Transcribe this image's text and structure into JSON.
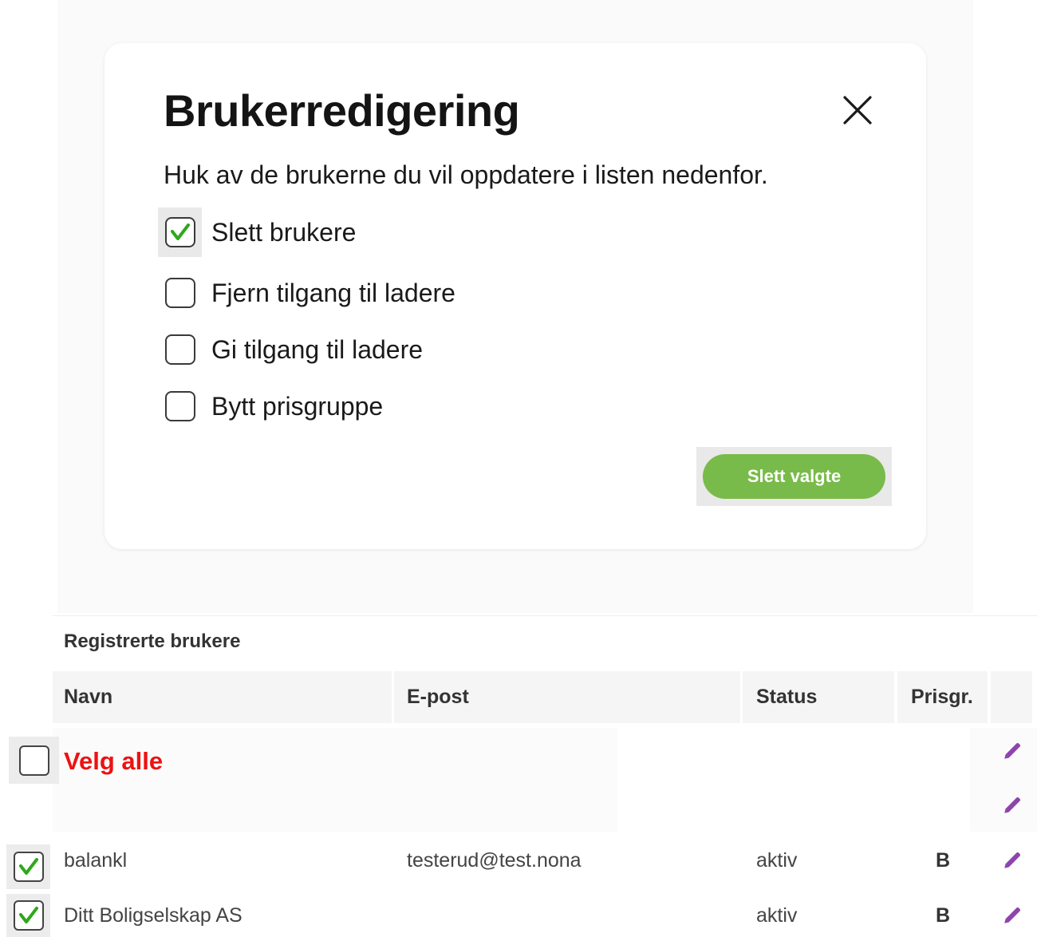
{
  "modal": {
    "title": "Brukerredigering",
    "description": "Huk av de brukerne du vil oppdatere i listen nedenfor.",
    "options": [
      {
        "label": "Slett brukere",
        "checked": true
      },
      {
        "label": "Fjern tilgang til ladere",
        "checked": false
      },
      {
        "label": "Gi tilgang til ladere",
        "checked": false
      },
      {
        "label": "Bytt prisgruppe",
        "checked": false
      }
    ],
    "submit_label": "Slett valgte",
    "icons": {
      "close": "close-icon",
      "check": "check-icon"
    }
  },
  "table": {
    "title": "Registrerte brukere",
    "columns": {
      "name": "Navn",
      "email": "E-post",
      "status": "Status",
      "price_group": "Prisgr."
    },
    "select_all_label": "Velg alle",
    "select_all_checked": false,
    "rows": [
      {
        "name": "balankl",
        "email": "testerud@test.nona",
        "status": "aktiv",
        "price_group": "B",
        "checked": true
      },
      {
        "name": "Ditt Boligselskap AS",
        "email": "",
        "status": "aktiv",
        "price_group": "B",
        "checked": true
      }
    ],
    "icons": {
      "edit": "pencil-icon"
    }
  },
  "colors": {
    "accent_green": "#79bb4a",
    "check_green": "#2ea81a",
    "select_all_red": "#ee1111",
    "edit_purple": "#8e44ad"
  }
}
